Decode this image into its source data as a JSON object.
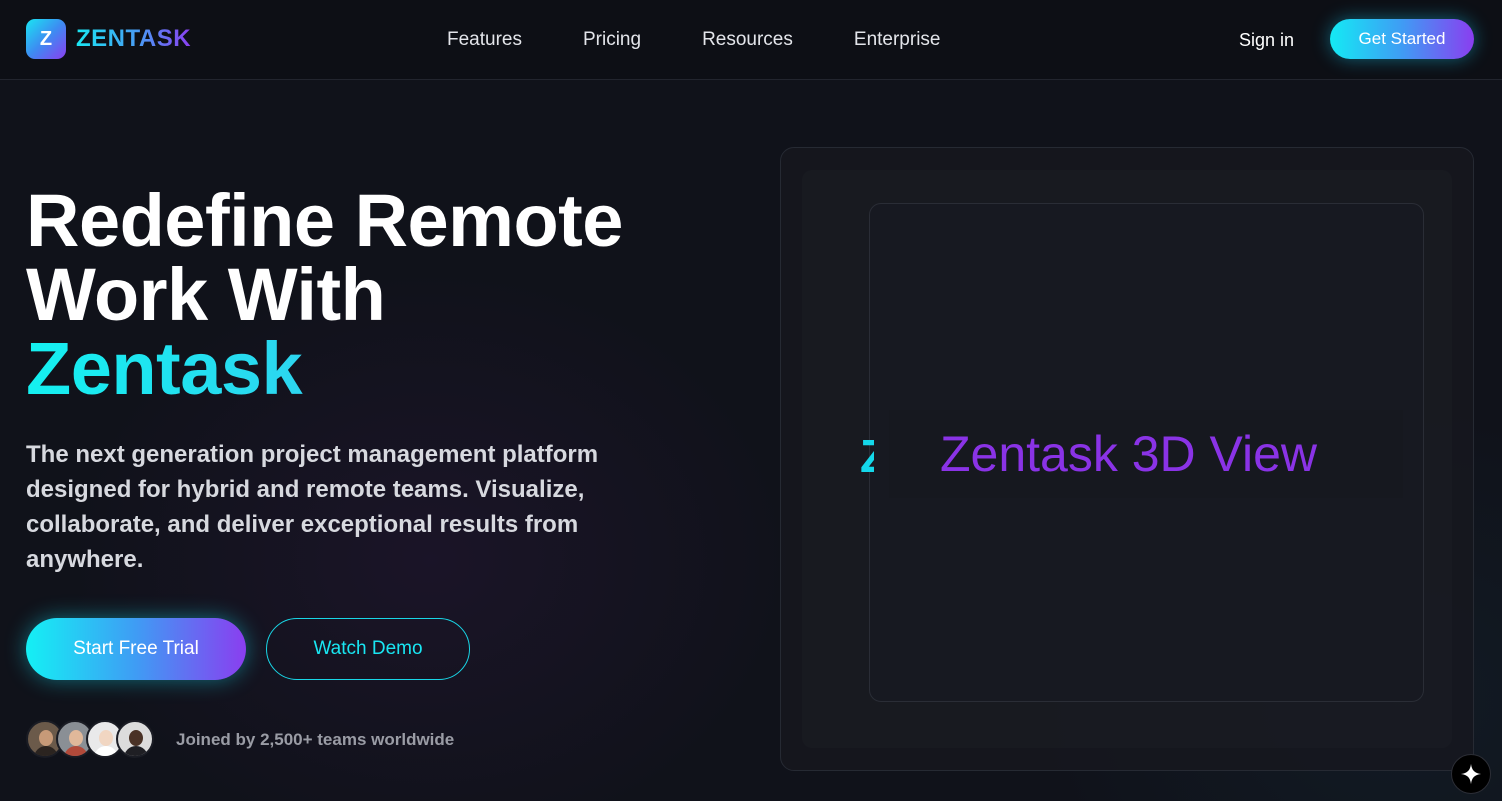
{
  "brand": {
    "logo_letter": "Z",
    "name": "ZENTASK",
    "gradient_colors": [
      "#19e6f2",
      "#3d8cf2",
      "#8a3ef0"
    ]
  },
  "nav": {
    "links": [
      "Features",
      "Pricing",
      "Resources",
      "Enterprise"
    ],
    "sign_in": "Sign in",
    "get_started": "Get Started"
  },
  "hero": {
    "title_line1": "Redefine Remote",
    "title_line2": "Work With",
    "title_accent": "Zentask",
    "subtitle": "The next generation project management platform designed for hybrid and remote teams. Visualize, collaborate, and deliver exceptional results from anywhere.",
    "primary_cta": "Start Free Trial",
    "secondary_cta": "Watch Demo",
    "social_proof": "Joined by 2,500+ teams worldwide",
    "avatar_icons": [
      "avatar-1",
      "avatar-2",
      "avatar-3",
      "avatar-4"
    ]
  },
  "preview": {
    "label": "Zentask 3D View",
    "ghost_letter": "Z"
  },
  "floating": {
    "icon": "sparkle-icon"
  },
  "colors": {
    "background": "#10121a",
    "cyan": "#19e6f2",
    "purple": "#8a3ef0",
    "preview_label": "#8a33e6"
  }
}
